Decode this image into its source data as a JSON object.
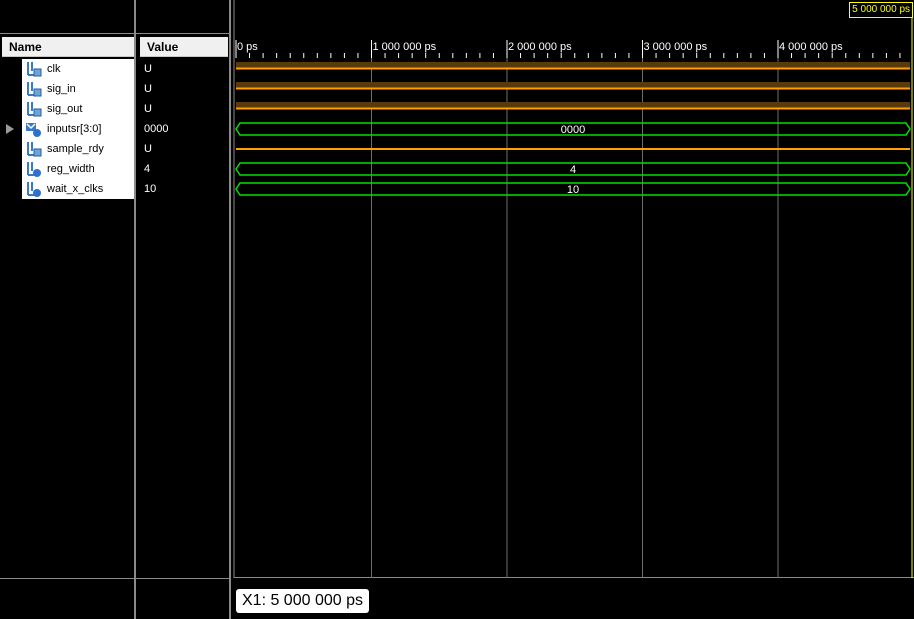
{
  "name_header": "Name",
  "value_header": "Value",
  "signals": [
    {
      "name": "clk",
      "value": "U",
      "icon": "bit-signal-icon",
      "expandable": false
    },
    {
      "name": "sig_in",
      "value": "U",
      "icon": "bit-signal-icon",
      "expandable": false
    },
    {
      "name": "sig_out",
      "value": "U",
      "icon": "bit-signal-icon",
      "expandable": false
    },
    {
      "name": "inputsr[3:0]",
      "value": "0000",
      "icon": "bus-signal-icon",
      "expandable": true
    },
    {
      "name": "sample_rdy",
      "value": "U",
      "icon": "bit-signal-icon",
      "expandable": false
    },
    {
      "name": "reg_width",
      "value": "4",
      "icon": "parameter-icon",
      "expandable": false
    },
    {
      "name": "wait_x_clks",
      "value": "10",
      "icon": "parameter-icon",
      "expandable": false
    }
  ],
  "timeline": {
    "ticks": [
      "0 ps",
      "1 000 000 ps",
      "2 000 000 ps",
      "3 000 000 ps",
      "4 000 000 ps"
    ],
    "cursor_time": "5 000 000 ps",
    "x1_label": "X1: 5 000 000 ps"
  },
  "waveforms": [
    {
      "signal": "clk",
      "kind": "undefined",
      "label": ""
    },
    {
      "signal": "sig_in",
      "kind": "undefined",
      "label": ""
    },
    {
      "signal": "sig_out",
      "kind": "undefined",
      "label": ""
    },
    {
      "signal": "inputsr[3:0]",
      "kind": "bus",
      "label": "0000"
    },
    {
      "signal": "sample_rdy",
      "kind": "undefined-low",
      "label": ""
    },
    {
      "signal": "reg_width",
      "kind": "bus",
      "label": "4"
    },
    {
      "signal": "wait_x_clks",
      "kind": "bus",
      "label": "10"
    }
  ],
  "colors": {
    "undefined_fill": "#5a3a0a",
    "undefined_line": "#ff9f00",
    "bus_line": "#00e000",
    "grid": "#6e6e6e",
    "cursor": "#ffff00"
  }
}
